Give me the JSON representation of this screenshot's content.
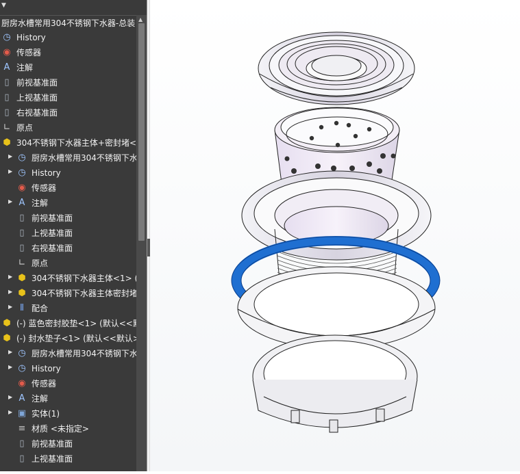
{
  "tree": {
    "root_label": "厨房水槽常用304不锈钢下水器-总装",
    "rows": [
      {
        "label": "History",
        "icon": "history-icon",
        "expand": false
      },
      {
        "label": "传感器",
        "icon": "sensor-icon",
        "expand": false
      },
      {
        "label": "注解",
        "icon": "annotation-icon",
        "expand": false
      },
      {
        "label": "前视基准面",
        "icon": "plane-icon",
        "expand": false
      },
      {
        "label": "上视基准面",
        "icon": "plane-icon",
        "expand": false
      },
      {
        "label": "右视基准面",
        "icon": "plane-icon",
        "expand": false
      },
      {
        "label": "原点",
        "icon": "origin-icon",
        "expand": false
      },
      {
        "label": "304不锈钢下水器主体+密封堵<1",
        "icon": "subassembly-icon",
        "expand": false
      },
      {
        "label": "厨房水槽常用304不锈钢下水",
        "icon": "history-icon",
        "expand": true
      },
      {
        "label": "History",
        "icon": "history-icon",
        "expand": true
      },
      {
        "label": "传感器",
        "icon": "sensor-icon",
        "expand": false
      },
      {
        "label": "注解",
        "icon": "annotation-icon",
        "expand": true
      },
      {
        "label": "前视基准面",
        "icon": "plane-icon",
        "expand": false
      },
      {
        "label": "上视基准面",
        "icon": "plane-icon",
        "expand": false
      },
      {
        "label": "右视基准面",
        "icon": "plane-icon",
        "expand": false
      },
      {
        "label": "原点",
        "icon": "origin-icon",
        "expand": false
      },
      {
        "label": "304不锈钢下水器主体<1> (",
        "icon": "part-icon",
        "expand": true
      },
      {
        "label": "304不锈钢下水器主体密封堵",
        "icon": "part-icon",
        "expand": true
      },
      {
        "label": "配合",
        "icon": "mates-icon",
        "expand": true
      },
      {
        "label": "(-) 蓝色密封胶垫<1> (默认<<默",
        "icon": "part-icon",
        "expand": false
      },
      {
        "label": "(-) 封水垫子<1> (默认<<默认>_",
        "icon": "part-icon",
        "expand": false
      },
      {
        "label": "厨房水槽常用304不锈钢下水",
        "icon": "history-icon",
        "expand": true
      },
      {
        "label": "History",
        "icon": "history-icon",
        "expand": true
      },
      {
        "label": "传感器",
        "icon": "sensor-icon",
        "expand": false
      },
      {
        "label": "注解",
        "icon": "annotation-icon",
        "expand": true
      },
      {
        "label": "实体(1)",
        "icon": "solid-body-icon",
        "expand": true
      },
      {
        "label": "材质 <未指定>",
        "icon": "material-icon",
        "expand": false
      },
      {
        "label": "前视基准面",
        "icon": "plane-icon",
        "expand": false
      },
      {
        "label": "上视基准面",
        "icon": "plane-icon",
        "expand": false
      }
    ]
  },
  "colors": {
    "panel_bg": "#3a3a3a",
    "text": "#f2f2f2",
    "part_yellow": "#e8c21a",
    "seal_blue": "#1f6fd1",
    "steel": "#e9e9ee",
    "steel_dark": "#a9a9b4"
  }
}
